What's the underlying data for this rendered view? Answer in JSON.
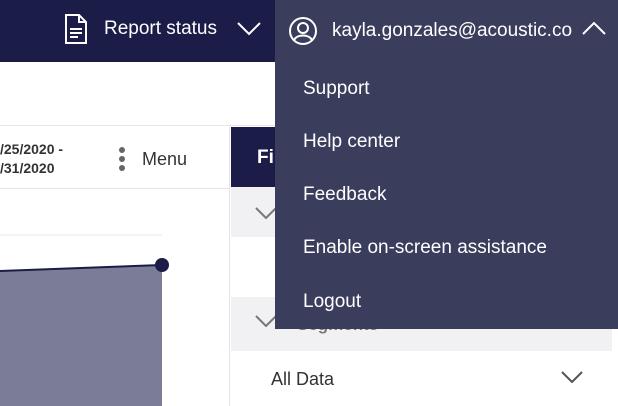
{
  "topbar": {
    "report_status_label": "Report status",
    "report_icon": "document-icon",
    "account_email": "kayla.gonzales@acoustic.co",
    "account_icon": "user-circle-icon"
  },
  "colors": {
    "nav_bg": "#1c1c48",
    "dropdown_bg": "#3a3d5c",
    "chart_fill": "#7b7d96"
  },
  "report_panel": {
    "date_range_line1": "/25/2020 -",
    "date_range_line2": "/31/2020",
    "menu_label": "Menu"
  },
  "filter_panel": {
    "header_label": "Fi",
    "segments_label": "Segments",
    "segment_select_value": "All Data"
  },
  "account_menu": {
    "items": [
      "Support",
      "Help center",
      "Feedback",
      "Enable on-screen assistance",
      "Logout"
    ]
  }
}
